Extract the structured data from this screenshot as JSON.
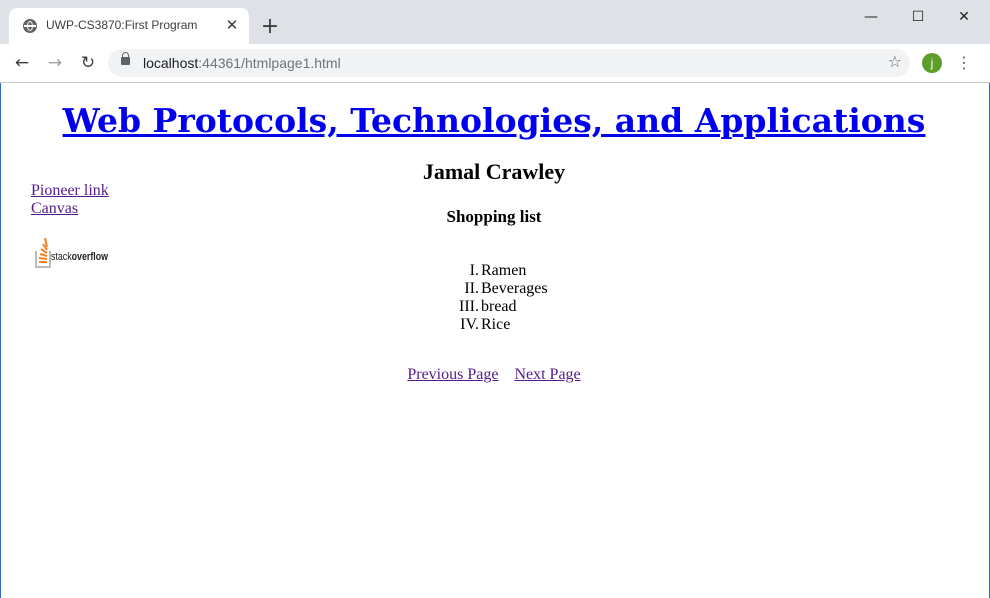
{
  "browser": {
    "tab_title": "UWP-CS3870:First Program",
    "url_host": "localhost",
    "url_rest": ":44361/htmlpage1.html",
    "profile_initial": "j"
  },
  "page": {
    "heading": "Web Protocols, Technologies, and Applications",
    "author": "Jamal Crawley",
    "side_links": [
      "Pioneer link",
      "Canvas"
    ],
    "logo_text_a": "stack",
    "logo_text_b": "overflow",
    "list_title": "Shopping list",
    "list_items": [
      {
        "num": "I.",
        "label": "Ramen"
      },
      {
        "num": "II.",
        "label": "Beverages"
      },
      {
        "num": "III.",
        "label": "bread"
      },
      {
        "num": "IV.",
        "label": "Rice"
      }
    ],
    "prev_label": "Previous Page",
    "next_label": "Next Page"
  },
  "colors": {
    "link_unvisited": "#0000ee",
    "link_visited": "#551a8b",
    "avatar": "#5d9d2a",
    "logo_orange": "#f48024"
  }
}
